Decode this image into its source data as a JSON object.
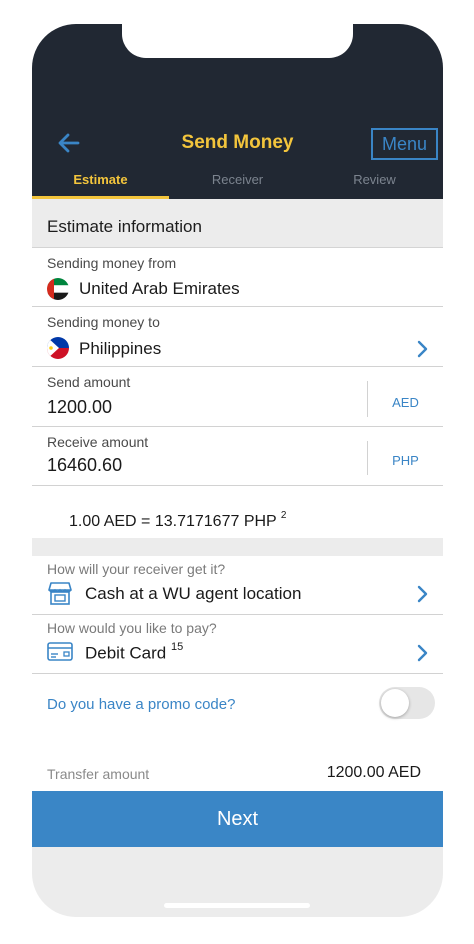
{
  "header": {
    "title": "Send Money",
    "menu_label": "Menu"
  },
  "tabs": [
    {
      "label": "Estimate",
      "active": true
    },
    {
      "label": "Receiver",
      "active": false
    },
    {
      "label": "Review",
      "active": false
    }
  ],
  "section": {
    "title": "Estimate information"
  },
  "from": {
    "label": "Sending money from",
    "value": "United Arab Emirates",
    "flag": "uae-flag"
  },
  "to": {
    "label": "Sending money to",
    "value": "Philippines",
    "flag": "philippines-flag"
  },
  "send_amount": {
    "label": "Send amount",
    "value": "1200.00",
    "currency": "AED"
  },
  "receive_amount": {
    "label": "Receive amount",
    "value": "16460.60",
    "currency": "PHP"
  },
  "rate": {
    "text": "1.00 AED = 13.7171677 PHP",
    "footnote": "2"
  },
  "delivery": {
    "question": "How will your receiver get it?",
    "value": "Cash at a WU agent location",
    "icon": "store-icon"
  },
  "payment": {
    "question": "How would you like to pay?",
    "value": "Debit Card",
    "footnote": "15",
    "icon": "card-icon"
  },
  "promo": {
    "label": "Do you have a promo code?",
    "enabled": false
  },
  "transfer": {
    "label": "Transfer amount",
    "value": "1200.00 AED"
  },
  "next_label": "Next",
  "colors": {
    "header_bg": "#212833",
    "accent_yellow": "#f3c53c",
    "accent_blue": "#3a86c6"
  }
}
